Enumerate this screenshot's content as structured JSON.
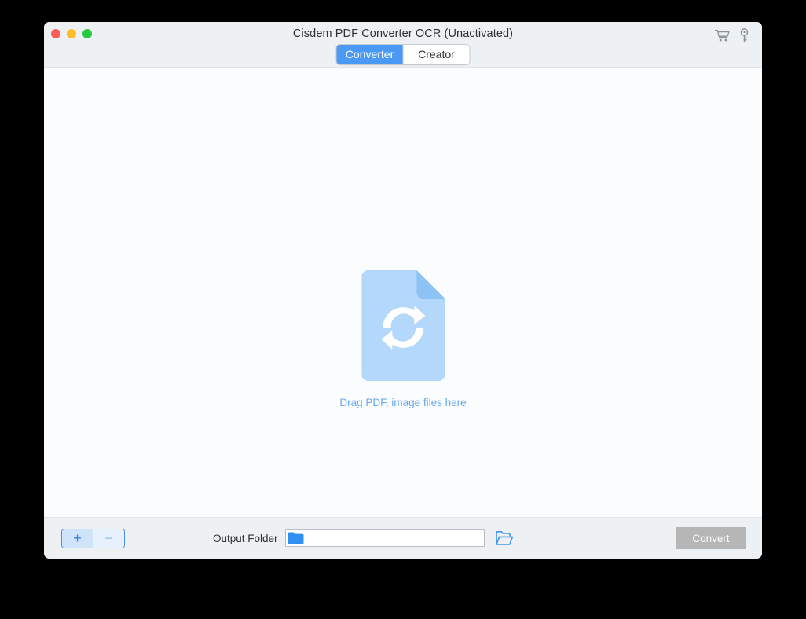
{
  "window": {
    "title": "Cisdem PDF Converter OCR (Unactivated)",
    "accent_color": "#4a9af5",
    "titlebar_color": "#edf1f4",
    "content_color": "#fbfcfe",
    "traffic_lights": {
      "close_color": "#fc5f57",
      "minimize_color": "#fdbc2e",
      "maximize_color": "#28c840"
    }
  },
  "tabs": [
    {
      "label": "Converter",
      "active": true
    },
    {
      "label": "Creator",
      "active": false
    }
  ],
  "title_actions": [
    {
      "icon": "shopping-cart-icon",
      "color": "#8a9199"
    },
    {
      "icon": "key-icon",
      "color": "#8a9199"
    }
  ],
  "drop_zone": {
    "hint": "Drag PDF, image files here",
    "hint_color": "#63aaf2",
    "doc_body_color": "#b3d8fb",
    "doc_fold_color": "#8cc3f4",
    "refresh_arrow_color": "#ffffff",
    "icon": "pdf-convert-document-icon"
  },
  "bottom_bar": {
    "add_button": {
      "icon": "plus-icon",
      "glyph": "+",
      "color": "#2f85ef"
    },
    "remove_button": {
      "icon": "minus-icon",
      "glyph": "−",
      "color": "#8fc3f2"
    },
    "output_folder_label": "Output Folder",
    "output_folder_path": "",
    "output_folder_placeholder": "",
    "folder_icon": "folder-icon",
    "browse_icon": "open-folder-icon",
    "browse_icon_color": "#3d95f0",
    "convert_label": "Convert",
    "convert_enabled": false,
    "convert_color": "#b6b6b6"
  }
}
